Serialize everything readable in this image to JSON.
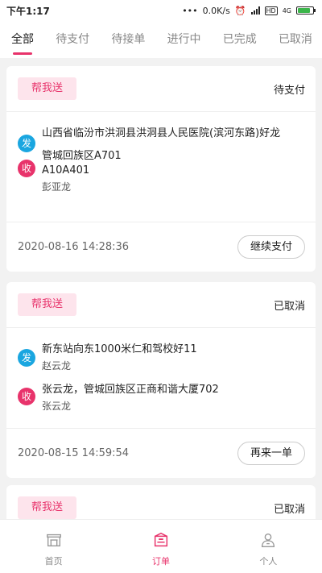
{
  "status_bar": {
    "time": "下午1:17",
    "network_speed": "0.0K/s",
    "network_type": "4G",
    "hd_badge": "HD",
    "battery_level": 0.85
  },
  "tabs": [
    {
      "label": "全部",
      "active": true
    },
    {
      "label": "待支付",
      "active": false
    },
    {
      "label": "待接单",
      "active": false
    },
    {
      "label": "进行中",
      "active": false
    },
    {
      "label": "已完成",
      "active": false
    },
    {
      "label": "已取消",
      "active": false
    }
  ],
  "orders": [
    {
      "service": "帮我送",
      "status": "待支付",
      "sender_icon": "发",
      "sender_address": "山西省临汾市洪洞县洪洞县人民医院(滨河东路)好龙",
      "sender_name": "",
      "receiver_icon": "收",
      "receiver_address": "管城回族区A701\nA10A401",
      "receiver_name": "彭亚龙",
      "time": "2020-08-16 14:28:36",
      "action": "继续支付"
    },
    {
      "service": "帮我送",
      "status": "已取消",
      "sender_icon": "发",
      "sender_address": "新东站向东1000米仁和驾校好11",
      "sender_name": "赵云龙",
      "receiver_icon": "收",
      "receiver_address": "张云龙，管城回族区正商和谐大厦702",
      "receiver_name": "张云龙",
      "time": "2020-08-15 14:59:54",
      "action": "再来一单"
    },
    {
      "service": "帮我送",
      "status": "已取消"
    }
  ],
  "tabbar": [
    {
      "label": "首页",
      "icon": "shop-icon",
      "active": false
    },
    {
      "label": "订单",
      "icon": "orders-icon",
      "active": true
    },
    {
      "label": "个人",
      "icon": "person-icon",
      "active": false
    }
  ],
  "colors": {
    "accent": "#e8336b",
    "sender_blue": "#1aa6e0",
    "tag_bg": "#fde4ec"
  }
}
